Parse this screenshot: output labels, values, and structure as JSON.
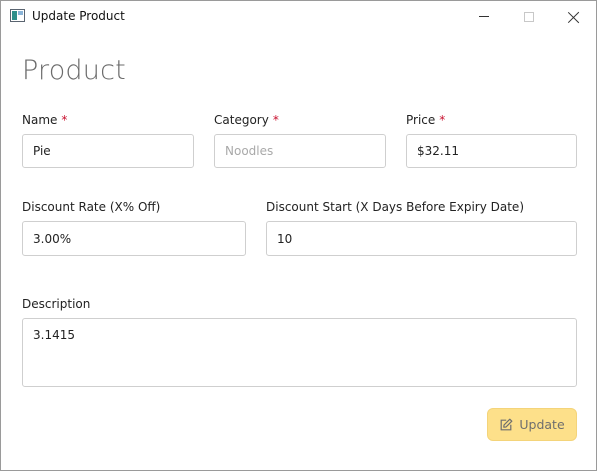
{
  "window": {
    "title": "Update Product",
    "icon": "app-window-icon",
    "controls": {
      "minimize": "minimize-icon",
      "maximize": "maximize-icon",
      "close": "close-icon"
    }
  },
  "form": {
    "heading": "Product",
    "required_marker": "*",
    "name": {
      "label": "Name",
      "value": "Pie"
    },
    "category": {
      "label": "Category",
      "placeholder": "Noodles",
      "value": ""
    },
    "price": {
      "label": "Price",
      "value": "$32.11"
    },
    "discount_rate": {
      "label": "Discount Rate (X% Off)",
      "value": "3.00%"
    },
    "discount_start": {
      "label": "Discount Start (X Days Before Expiry Date)",
      "value": "10"
    },
    "description": {
      "label": "Description",
      "value": "3.1415"
    },
    "update_button": {
      "label": "Update",
      "icon": "edit-icon",
      "color": "#fde08a"
    }
  },
  "colors": {
    "required": "#c8102e",
    "heading": "#6b6b6b",
    "field_border": "#cfcfcf"
  }
}
